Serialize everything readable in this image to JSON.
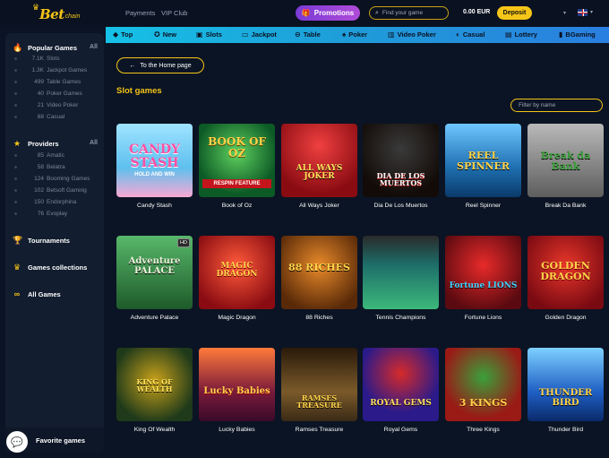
{
  "header": {
    "logo_text": "Bet",
    "logo_sub": "chain",
    "links": [
      "Payments",
      "VIP Club"
    ],
    "promotions_label": "Promotions",
    "search_placeholder": "Find your game",
    "balance": "0.00 EUR",
    "deposit_label": "Deposit"
  },
  "categories": [
    {
      "label": "Top",
      "icon": "diamond-icon"
    },
    {
      "label": "New",
      "icon": "star-icon"
    },
    {
      "label": "Slots",
      "icon": "slot-icon"
    },
    {
      "label": "Jackpot",
      "icon": "jackpot-icon"
    },
    {
      "label": "Table",
      "icon": "table-icon"
    },
    {
      "label": "Poker",
      "icon": "spade-icon"
    },
    {
      "label": "Video Poker",
      "icon": "video-poker-icon"
    },
    {
      "label": "Casual",
      "icon": "casual-icon"
    },
    {
      "label": "Lottery",
      "icon": "lottery-icon"
    },
    {
      "label": "BGaming",
      "icon": "bgaming-icon"
    }
  ],
  "sidebar": {
    "popular": {
      "title": "Popular Games",
      "all_label": "All",
      "items": [
        {
          "count": "7.1K",
          "label": "Slots"
        },
        {
          "count": "1.3K",
          "label": "Jackpot Games"
        },
        {
          "count": "499",
          "label": "Table Games"
        },
        {
          "count": "40",
          "label": "Poker Games"
        },
        {
          "count": "21",
          "label": "Video Poker"
        },
        {
          "count": "88",
          "label": "Casual"
        }
      ]
    },
    "providers": {
      "title": "Providers",
      "all_label": "All",
      "items": [
        {
          "count": "85",
          "label": "Amatic"
        },
        {
          "count": "58",
          "label": "Belatra"
        },
        {
          "count": "124",
          "label": "Booming Games"
        },
        {
          "count": "102",
          "label": "Betsoft Gaming"
        },
        {
          "count": "150",
          "label": "Endorphina"
        },
        {
          "count": "76",
          "label": "Evoplay"
        }
      ]
    },
    "tournaments_label": "Tournaments",
    "collections_label": "Games collections",
    "all_games_label": "All Games",
    "favorite_label": "Favorite games"
  },
  "main": {
    "home_label": "To the Home page",
    "section_title": "Slot games",
    "filter_placeholder": "Filter by name"
  },
  "games": [
    {
      "name": "Candy Stash",
      "title": "CANDY STASH",
      "sub": "HOLD AND WIN",
      "bg": "#7fd3f0"
    },
    {
      "name": "Book of Oz",
      "title": "BOOK OF OZ",
      "sub": "RESPIN FEATURE",
      "bg": "#1b7a3a"
    },
    {
      "name": "All Ways Joker",
      "title": "ALL WAYS JOKER",
      "sub": "",
      "bg": "#c4151c"
    },
    {
      "name": "Dia De Los Muertos",
      "title": "DIA DE LOS MUERTOS",
      "sub": "",
      "bg": "#2a1a14"
    },
    {
      "name": "Reel Spinner",
      "title": "REEL SPINNER",
      "sub": "",
      "bg": "#1e6fb0"
    },
    {
      "name": "Break Da Bank",
      "title": "Break da Bank",
      "sub": "",
      "bg": "#6a6a6a"
    },
    {
      "name": "Adventure Palace",
      "title": "Adventure PALACE",
      "sub": "",
      "bg": "#2c7a3c"
    },
    {
      "name": "Magic Dragon",
      "title": "MAGIC DRAGON",
      "sub": "",
      "bg": "#c21b1b"
    },
    {
      "name": "88 Riches",
      "title": "88 RICHES",
      "sub": "",
      "bg": "#8a4a14"
    },
    {
      "name": "Tennis Champions",
      "title": "",
      "sub": "",
      "bg": "#1d6f6a"
    },
    {
      "name": "Fortune Lions",
      "title": "Fortune LIONS",
      "sub": "",
      "bg": "#a5141a"
    },
    {
      "name": "Golden Dragon",
      "title": "GOLDEN DRAGON",
      "sub": "",
      "bg": "#b3161c"
    },
    {
      "name": "King Of Wealth",
      "title": "KING OF WEALTH",
      "sub": "",
      "bg": "#1f4a2a"
    },
    {
      "name": "Lucky Babies",
      "title": "Lucky Babies",
      "sub": "",
      "bg": "#7a1a3a"
    },
    {
      "name": "Ramses Treasure",
      "title": "RAMSES TREASURE",
      "sub": "",
      "bg": "#3a2a16"
    },
    {
      "name": "Royal Gems",
      "title": "ROYAL GEMS",
      "sub": "",
      "bg": "#2a1a8a"
    },
    {
      "name": "Three Kings",
      "title": "3 KINGS",
      "sub": "",
      "bg": "#9a1a16"
    },
    {
      "name": "Thunder Bird",
      "title": "THUNDER BIRD",
      "sub": "",
      "bg": "#1f5fc4"
    }
  ]
}
